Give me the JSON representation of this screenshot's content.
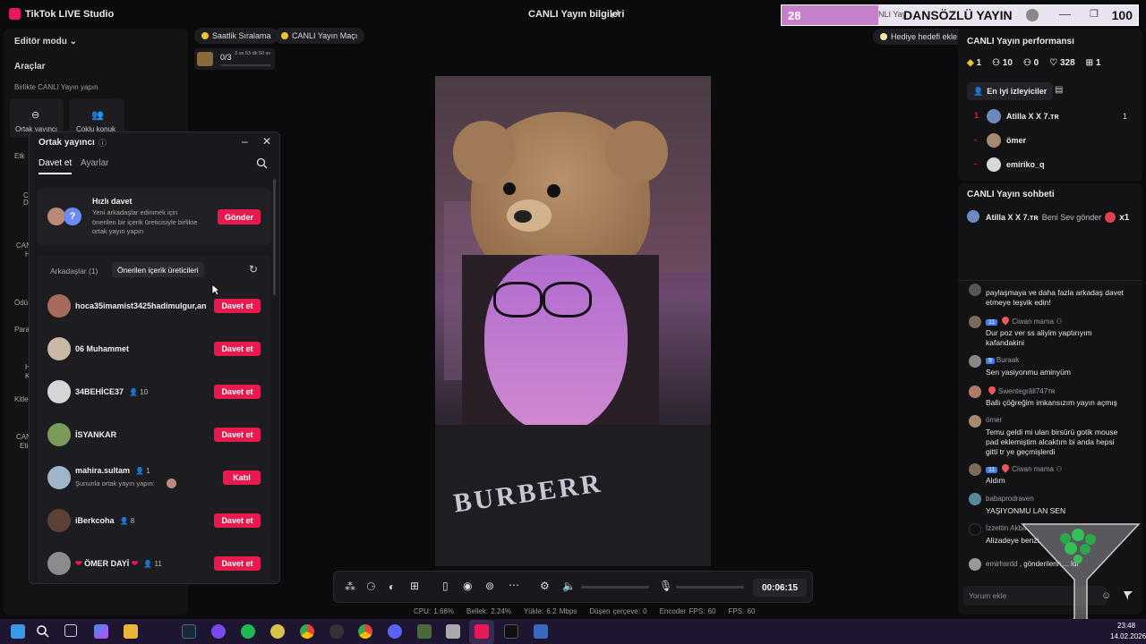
{
  "app": {
    "title": "TikTok LIVE Studio",
    "center_title": "CANLI Yayın bilgileri"
  },
  "banner": {
    "left_number": "28",
    "title": "DANSÖZLÜ YAYIN",
    "partial_text": "NLI Yay",
    "right_number": "100"
  },
  "left_panel": {
    "editor_mode": "Editör modu",
    "tools": "Araçlar",
    "live_together": "Birlikte CANLI Yayın yapın",
    "cohost_tile": "Ortak yayıncı",
    "multi_guest_tile": "Çoklu konuk",
    "partial_labels": [
      "Etk",
      "C",
      "D",
      "CAN",
      "H",
      "Ödü",
      "Para",
      "H",
      "K",
      "Kitle",
      "CAN",
      "Eti"
    ]
  },
  "pills": {
    "hourly_ranking": "Saatlik Sıralama",
    "live_match": "CANLI Yayın Maçı",
    "progress": "0/3",
    "timer": "3 sa 53 dk 50 sn",
    "gift_goal": "Hediye hedefi ekle"
  },
  "popup": {
    "title": "Ortak yayıncı",
    "tab_invite": "Davet et",
    "tab_settings": "Ayarlar",
    "quick_invite_title": "Hızlı davet",
    "quick_invite_desc": "Yeni arkadaşlar edinmek için önerilen bir içerik üreticisiyle birlikte ortak yayın yapın",
    "send_button": "Gönder",
    "friends_tab": "Arkadaşlar (1)",
    "suggested_tab": "Önerilen içerik üreticileri",
    "users": [
      {
        "name": "hoca35imamist3425hadimulgur,an",
        "count": "",
        "button": "Davet et",
        "sub": ""
      },
      {
        "name": "06 Muhammet",
        "count": "",
        "button": "Davet et",
        "sub": ""
      },
      {
        "name": "34BEHİCE37",
        "count": "10",
        "button": "Davet et",
        "sub": ""
      },
      {
        "name": "İSYANKAR",
        "count": "",
        "button": "Davet et",
        "sub": ""
      },
      {
        "name": "mahira.sultam",
        "count": "1",
        "button": "Katıl",
        "sub": "Şununla ortak yayın yapın:"
      },
      {
        "name": "iBerkcoha",
        "count": "8",
        "button": "Davet et",
        "sub": ""
      },
      {
        "name": "ÖMER DAYİ",
        "count": "11",
        "button": "Davet et",
        "sub": ""
      }
    ]
  },
  "toolbar": {
    "duration": "00:06:15"
  },
  "stats": {
    "cpu": "CPU: 1.66%",
    "memory": "Bellek: 2.24%",
    "upload": "Yükle: 6.2 Mbps",
    "dropped": "Düşen çerçeve: 0",
    "encoder_fps": "Encoder FPS: 60",
    "fps": "FPS: 60"
  },
  "performance": {
    "title": "CANLI Yayın performansı",
    "metrics": [
      "1",
      "10",
      "0",
      "328",
      "1"
    ],
    "top_viewers_label": "En iyi izleyiciler",
    "viewers": [
      {
        "rank": "1",
        "name": "Atilla X X 7.ᴛʀ",
        "score": "1"
      },
      {
        "rank": "-",
        "name": "ömer",
        "score": ""
      },
      {
        "rank": "-",
        "name": "emiriko_q",
        "score": ""
      }
    ]
  },
  "chat": {
    "title": "CANLI Yayın sohbeti",
    "gift_user": "Atilla X X 7.ᴛʀ",
    "gift_text": "Beni Sev gönder",
    "gift_count": "x1",
    "messages": [
      {
        "name": "",
        "badge": "",
        "text": "paylaşmaya ve daha fazla arkadaş davet etmeye teşvik edin!"
      },
      {
        "name": "Ciwan mama",
        "badge": "11",
        "text": "Dur poz ver ss aliyim yaptırıyım kafandakini"
      },
      {
        "name": "Buraak",
        "badge": "9",
        "text": "Sen yasiyonmu aminyüm"
      },
      {
        "name": "Swentegrâll747ᴛʀ",
        "badge": "",
        "text": "Ballı çöğreğim imkansızım yayın açmış"
      },
      {
        "name": "ömer",
        "badge": "",
        "text": "Temu geldi mi ulan birsürü gotik mouse pad eklemiştim alcaktım bi anda hepsi gitti tr ye geçmişlerdi"
      },
      {
        "name": "Ciwan mama",
        "badge": "11",
        "text": "Aldım"
      },
      {
        "name": "babaprodraven",
        "badge": "",
        "text": "YAŞIYONMU LAN SEN"
      },
      {
        "name": "İzzettin Akba",
        "badge": "",
        "text": "Alizadeye benzi"
      },
      {
        "name": "emirhsrdd",
        "badge": "",
        "text": ", gönderilerin ... ldı"
      }
    ],
    "comment_placeholder": "Yorum ekle"
  },
  "taskbar": {
    "time": "23:48",
    "date": "14.02.2026"
  }
}
